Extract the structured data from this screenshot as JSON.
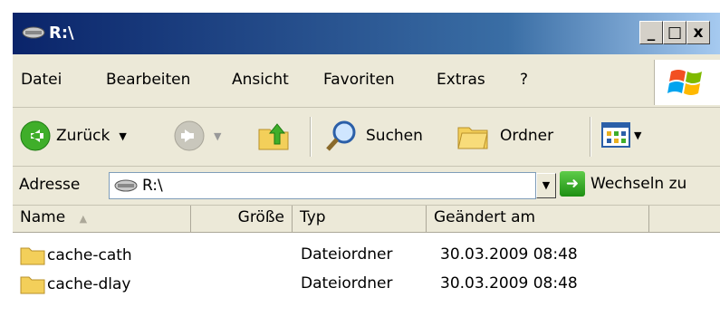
{
  "window": {
    "title": "R:\\"
  },
  "caption_buttons": {
    "minimize": "_",
    "maximize": "□",
    "close": "x"
  },
  "menu": [
    {
      "label": "Datei"
    },
    {
      "label": "Bearbeiten"
    },
    {
      "label": "Ansicht"
    },
    {
      "label": "Favoriten"
    },
    {
      "label": "Extras"
    },
    {
      "label": "?"
    }
  ],
  "toolbar": {
    "back_label": "Zurück",
    "search_label": "Suchen",
    "folders_label": "Ordner"
  },
  "address": {
    "label": "Adresse",
    "value": "R:\\",
    "go_label": "Wechseln zu"
  },
  "columns": [
    "Name",
    "Größe",
    "Typ",
    "Geändert am"
  ],
  "files": [
    {
      "name": "cache-cath",
      "size": "",
      "type": "Dateiordner",
      "modified": "30.03.2009 08:48"
    },
    {
      "name": "cache-dlay",
      "size": "",
      "type": "Dateiordner",
      "modified": "30.03.2009 08:48"
    }
  ],
  "icons": {
    "drive": "network-drive-icon",
    "back": "back-arrow-icon",
    "forward": "forward-arrow-icon",
    "up": "folder-up-icon",
    "search": "magnifier-icon",
    "folders": "folders-icon",
    "views": "views-icon",
    "go": "go-arrow-icon",
    "folder": "folder-icon"
  },
  "colors": {
    "title_bar": "#0a246a",
    "chrome": "#ece9d8",
    "go_green": "#1d8f12"
  }
}
